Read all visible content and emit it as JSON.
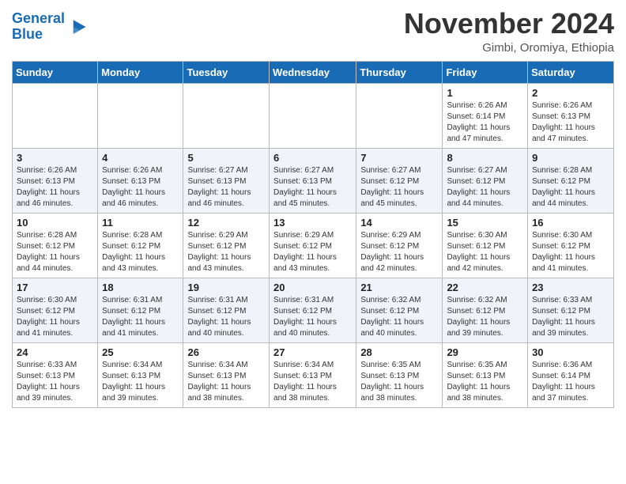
{
  "header": {
    "logo_line1": "General",
    "logo_line2": "Blue",
    "month": "November 2024",
    "location": "Gimbi, Oromiya, Ethiopia"
  },
  "weekdays": [
    "Sunday",
    "Monday",
    "Tuesday",
    "Wednesday",
    "Thursday",
    "Friday",
    "Saturday"
  ],
  "weeks": [
    [
      {
        "day": "",
        "info": ""
      },
      {
        "day": "",
        "info": ""
      },
      {
        "day": "",
        "info": ""
      },
      {
        "day": "",
        "info": ""
      },
      {
        "day": "",
        "info": ""
      },
      {
        "day": "1",
        "info": "Sunrise: 6:26 AM\nSunset: 6:14 PM\nDaylight: 11 hours\nand 47 minutes."
      },
      {
        "day": "2",
        "info": "Sunrise: 6:26 AM\nSunset: 6:13 PM\nDaylight: 11 hours\nand 47 minutes."
      }
    ],
    [
      {
        "day": "3",
        "info": "Sunrise: 6:26 AM\nSunset: 6:13 PM\nDaylight: 11 hours\nand 46 minutes."
      },
      {
        "day": "4",
        "info": "Sunrise: 6:26 AM\nSunset: 6:13 PM\nDaylight: 11 hours\nand 46 minutes."
      },
      {
        "day": "5",
        "info": "Sunrise: 6:27 AM\nSunset: 6:13 PM\nDaylight: 11 hours\nand 46 minutes."
      },
      {
        "day": "6",
        "info": "Sunrise: 6:27 AM\nSunset: 6:13 PM\nDaylight: 11 hours\nand 45 minutes."
      },
      {
        "day": "7",
        "info": "Sunrise: 6:27 AM\nSunset: 6:12 PM\nDaylight: 11 hours\nand 45 minutes."
      },
      {
        "day": "8",
        "info": "Sunrise: 6:27 AM\nSunset: 6:12 PM\nDaylight: 11 hours\nand 44 minutes."
      },
      {
        "day": "9",
        "info": "Sunrise: 6:28 AM\nSunset: 6:12 PM\nDaylight: 11 hours\nand 44 minutes."
      }
    ],
    [
      {
        "day": "10",
        "info": "Sunrise: 6:28 AM\nSunset: 6:12 PM\nDaylight: 11 hours\nand 44 minutes."
      },
      {
        "day": "11",
        "info": "Sunrise: 6:28 AM\nSunset: 6:12 PM\nDaylight: 11 hours\nand 43 minutes."
      },
      {
        "day": "12",
        "info": "Sunrise: 6:29 AM\nSunset: 6:12 PM\nDaylight: 11 hours\nand 43 minutes."
      },
      {
        "day": "13",
        "info": "Sunrise: 6:29 AM\nSunset: 6:12 PM\nDaylight: 11 hours\nand 43 minutes."
      },
      {
        "day": "14",
        "info": "Sunrise: 6:29 AM\nSunset: 6:12 PM\nDaylight: 11 hours\nand 42 minutes."
      },
      {
        "day": "15",
        "info": "Sunrise: 6:30 AM\nSunset: 6:12 PM\nDaylight: 11 hours\nand 42 minutes."
      },
      {
        "day": "16",
        "info": "Sunrise: 6:30 AM\nSunset: 6:12 PM\nDaylight: 11 hours\nand 41 minutes."
      }
    ],
    [
      {
        "day": "17",
        "info": "Sunrise: 6:30 AM\nSunset: 6:12 PM\nDaylight: 11 hours\nand 41 minutes."
      },
      {
        "day": "18",
        "info": "Sunrise: 6:31 AM\nSunset: 6:12 PM\nDaylight: 11 hours\nand 41 minutes."
      },
      {
        "day": "19",
        "info": "Sunrise: 6:31 AM\nSunset: 6:12 PM\nDaylight: 11 hours\nand 40 minutes."
      },
      {
        "day": "20",
        "info": "Sunrise: 6:31 AM\nSunset: 6:12 PM\nDaylight: 11 hours\nand 40 minutes."
      },
      {
        "day": "21",
        "info": "Sunrise: 6:32 AM\nSunset: 6:12 PM\nDaylight: 11 hours\nand 40 minutes."
      },
      {
        "day": "22",
        "info": "Sunrise: 6:32 AM\nSunset: 6:12 PM\nDaylight: 11 hours\nand 39 minutes."
      },
      {
        "day": "23",
        "info": "Sunrise: 6:33 AM\nSunset: 6:12 PM\nDaylight: 11 hours\nand 39 minutes."
      }
    ],
    [
      {
        "day": "24",
        "info": "Sunrise: 6:33 AM\nSunset: 6:13 PM\nDaylight: 11 hours\nand 39 minutes."
      },
      {
        "day": "25",
        "info": "Sunrise: 6:34 AM\nSunset: 6:13 PM\nDaylight: 11 hours\nand 39 minutes."
      },
      {
        "day": "26",
        "info": "Sunrise: 6:34 AM\nSunset: 6:13 PM\nDaylight: 11 hours\nand 38 minutes."
      },
      {
        "day": "27",
        "info": "Sunrise: 6:34 AM\nSunset: 6:13 PM\nDaylight: 11 hours\nand 38 minutes."
      },
      {
        "day": "28",
        "info": "Sunrise: 6:35 AM\nSunset: 6:13 PM\nDaylight: 11 hours\nand 38 minutes."
      },
      {
        "day": "29",
        "info": "Sunrise: 6:35 AM\nSunset: 6:13 PM\nDaylight: 11 hours\nand 38 minutes."
      },
      {
        "day": "30",
        "info": "Sunrise: 6:36 AM\nSunset: 6:14 PM\nDaylight: 11 hours\nand 37 minutes."
      }
    ]
  ]
}
